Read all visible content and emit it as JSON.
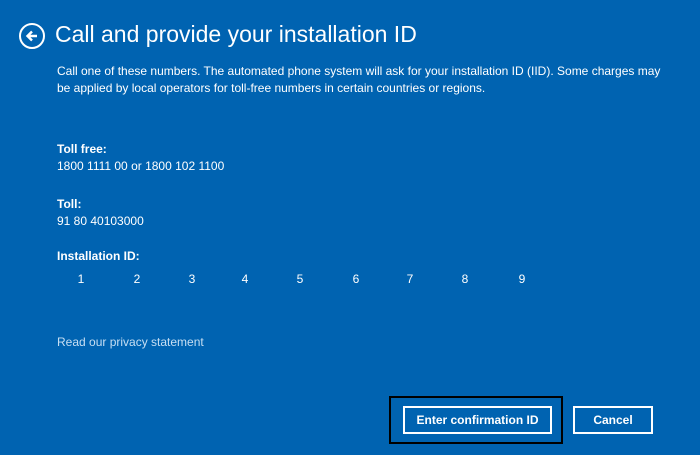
{
  "header": {
    "title": "Call and provide your installation ID",
    "back_icon": "back-arrow-icon"
  },
  "description": "Call one of these numbers. The automated phone system will ask for your installation ID (IID). Some charges may be applied by local operators for toll-free numbers in certain countries or regions.",
  "toll_free": {
    "label": "Toll free:",
    "value": "1800 1111 00 or 1800 102 1100"
  },
  "toll": {
    "label": "Toll:",
    "value": "91 80 40103000"
  },
  "installation_id": {
    "label": "Installation ID:",
    "groups": [
      "1",
      "2",
      "3",
      "4",
      "5",
      "6",
      "7",
      "8",
      "9"
    ]
  },
  "privacy_link": "Read our privacy statement",
  "buttons": {
    "primary_label": "Enter confirmation ID",
    "secondary_label": "Cancel"
  },
  "colors": {
    "background": "#0063b1",
    "text": "#ffffff",
    "link": "#c7dff3",
    "focus_ring": "#000000"
  }
}
